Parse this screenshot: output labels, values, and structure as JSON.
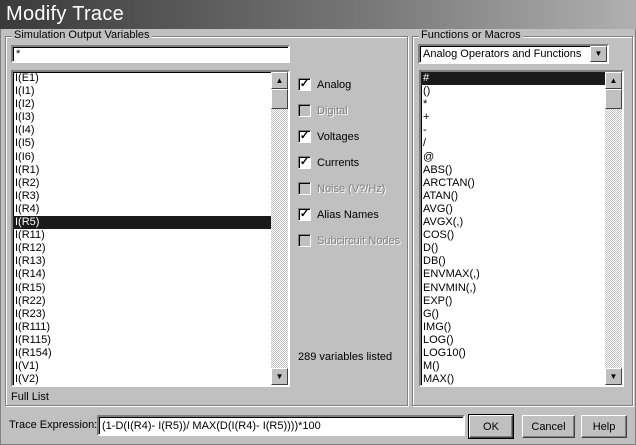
{
  "title": "Modify Trace",
  "left": {
    "group_label": "Simulation Output Variables",
    "filter_value": "*",
    "variables": [
      "I(E1)",
      "I(I1)",
      "I(I2)",
      "I(I3)",
      "I(I4)",
      "I(I5)",
      "I(I6)",
      "I(R1)",
      "I(R2)",
      "I(R3)",
      "I(R4)",
      "I(R5)",
      "I(R11)",
      "I(R12)",
      "I(R13)",
      "I(R14)",
      "I(R15)",
      "I(R22)",
      "I(R23)",
      "I(R111)",
      "I(R115)",
      "I(R154)",
      "I(V1)",
      "I(V2)"
    ],
    "selected": "I(R5)",
    "list_label": "Full List"
  },
  "options": [
    {
      "label": "Analog",
      "checked": true,
      "enabled": true
    },
    {
      "label": "Digital",
      "checked": false,
      "enabled": false
    },
    {
      "label": "Voltages",
      "checked": true,
      "enabled": true
    },
    {
      "label": "Currents",
      "checked": true,
      "enabled": true
    },
    {
      "label": "Noise (V?/Hz)",
      "checked": false,
      "enabled": false
    },
    {
      "label": "Alias Names",
      "checked": true,
      "enabled": true
    },
    {
      "label": "Subcircuit Nodes",
      "checked": false,
      "enabled": false
    }
  ],
  "count_text": "289 variables listed",
  "right": {
    "group_label": "Functions or Macros",
    "dropdown_value": "Analog Operators and Functions",
    "functions": [
      "#",
      "()",
      "*",
      "+",
      "-",
      "/",
      "@",
      "ABS()",
      "ARCTAN()",
      "ATAN()",
      "AVG()",
      "AVGX(,)",
      "COS()",
      "D()",
      "DB()",
      "ENVMAX(,)",
      "ENVMIN(,)",
      "EXP()",
      "G()",
      "IMG()",
      "LOG()",
      "LOG10()",
      "M()",
      "MAX()"
    ],
    "selected": "#"
  },
  "trace": {
    "label": "Trace Expression:",
    "value": "(1-D(I(R4)- I(R5))/ MAX(D(I(R4)- I(R5))))*100"
  },
  "buttons": {
    "ok": "OK",
    "cancel": "Cancel",
    "help": "Help"
  }
}
